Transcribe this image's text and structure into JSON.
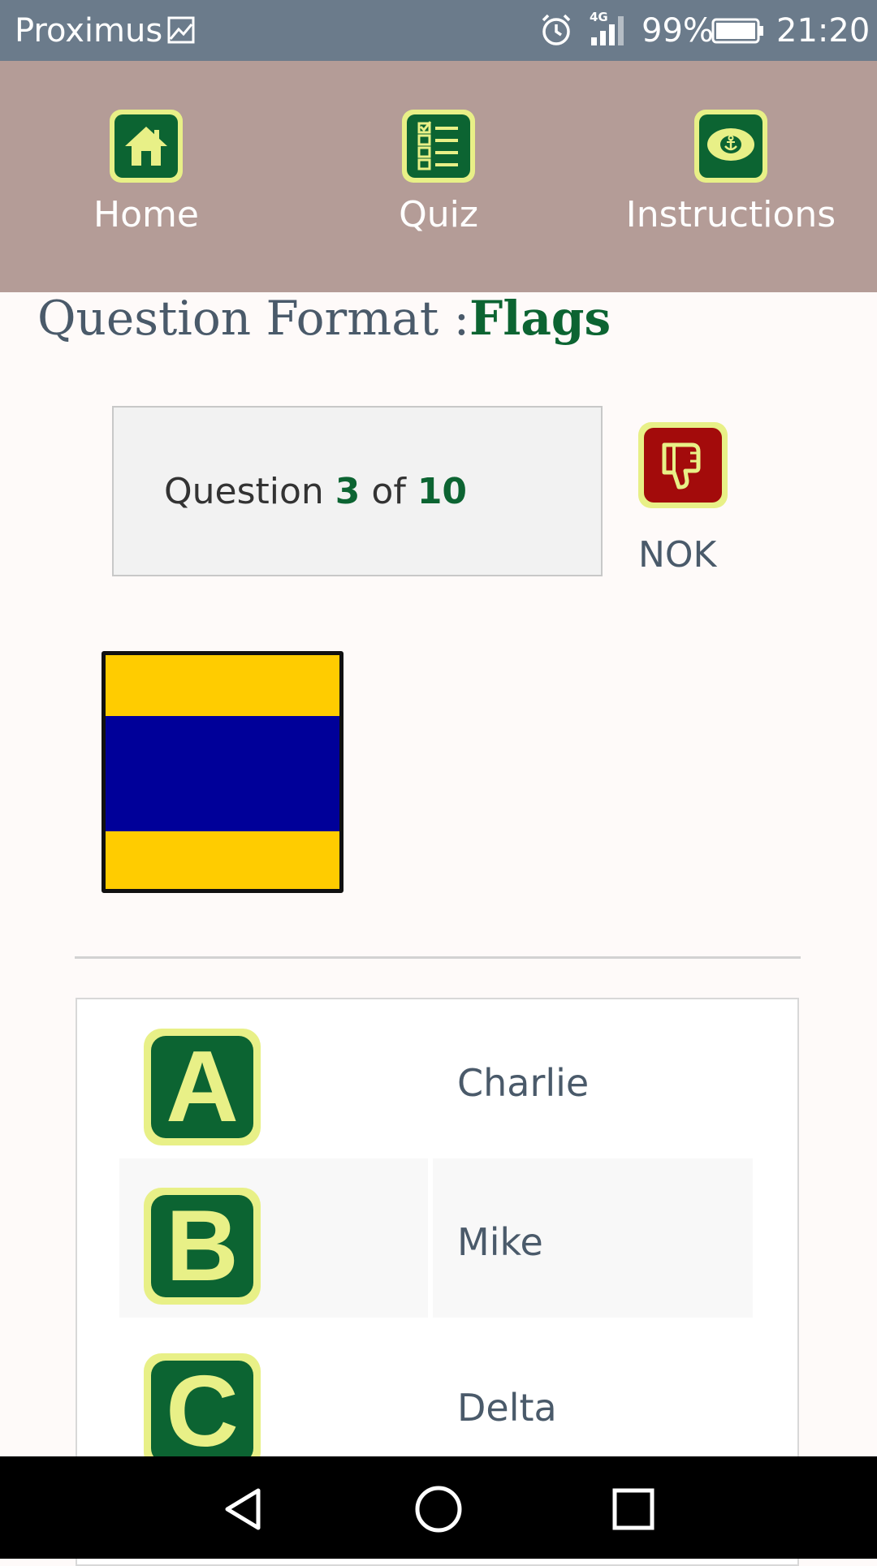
{
  "status_bar": {
    "carrier": "Proximus",
    "network": "4G",
    "battery": "99%",
    "time": "21:20"
  },
  "nav": {
    "items": [
      {
        "label": "Home",
        "icon": "home-icon"
      },
      {
        "label": "Quiz",
        "icon": "checklist-icon"
      },
      {
        "label": "Instructions",
        "icon": "captain-hat-icon"
      }
    ]
  },
  "page": {
    "title_prefix": "Question Format :",
    "title_value": "Flags"
  },
  "question": {
    "label_prefix": "Question ",
    "current": "3",
    "separator": " of ",
    "total": "10"
  },
  "result": {
    "icon": "thumbs-down-icon",
    "label": "NOK"
  },
  "flag": {
    "bands": [
      "#ffcc00",
      "#000099",
      "#ffcc00"
    ]
  },
  "answers": [
    {
      "letter": "A",
      "text": "Charlie"
    },
    {
      "letter": "B",
      "text": "Mike"
    },
    {
      "letter": "C",
      "text": "Delta"
    }
  ],
  "colors": {
    "brand_green": "#0c6432",
    "tile_yellow": "#e8f087",
    "nav_background": "#b49c97",
    "status_bar": "#6b7b8b",
    "nok_red": "#a30b0b"
  }
}
